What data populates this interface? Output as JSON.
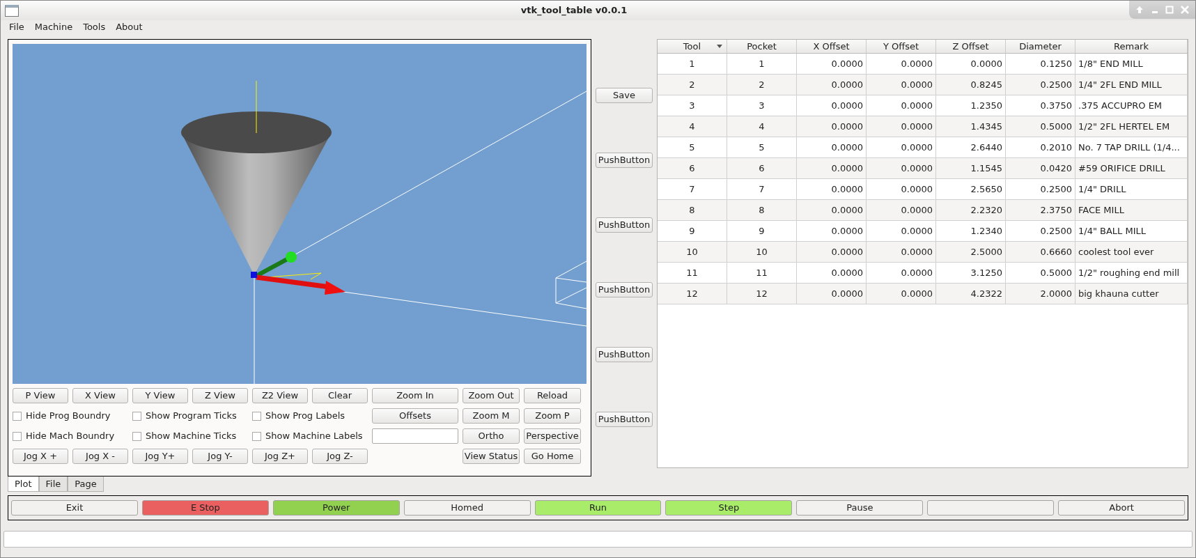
{
  "window": {
    "title": "vtk_tool_table v0.0.1"
  },
  "menu": [
    "File",
    "Machine",
    "Tools",
    "About"
  ],
  "view_controls": [
    [
      {
        "kind": "button",
        "label": "P View"
      },
      {
        "kind": "button",
        "label": "X View"
      },
      {
        "kind": "button",
        "label": "Y View"
      },
      {
        "kind": "button",
        "label": "Z View"
      },
      {
        "kind": "button",
        "label": "Z2 View"
      },
      {
        "kind": "button",
        "label": "Clear"
      },
      {
        "kind": "button",
        "label": "Zoom In"
      },
      {
        "kind": "button",
        "label": "Zoom Out"
      },
      {
        "kind": "button",
        "label": "Reload"
      }
    ],
    [
      {
        "kind": "checkbox",
        "label": "Hide Prog Boundry",
        "checked": false
      },
      {
        "kind": "checkbox",
        "label": "Show Program Ticks",
        "checked": false
      },
      {
        "kind": "checkbox",
        "label": "Show Prog Labels",
        "checked": false
      },
      {
        "kind": "button",
        "label": "Offsets"
      },
      {
        "kind": "button",
        "label": "Zoom M"
      },
      {
        "kind": "button",
        "label": "Zoom P"
      }
    ],
    [
      {
        "kind": "checkbox",
        "label": "Hide Mach Boundry",
        "checked": false
      },
      {
        "kind": "checkbox",
        "label": "Show Machine Ticks",
        "checked": false
      },
      {
        "kind": "checkbox",
        "label": "Show Machine Labels",
        "checked": false
      },
      {
        "kind": "input"
      },
      {
        "kind": "button",
        "label": "Ortho"
      },
      {
        "kind": "button",
        "label": "Perspective"
      }
    ],
    [
      {
        "kind": "button",
        "label": "Jog X +"
      },
      {
        "kind": "button",
        "label": "Jog X -"
      },
      {
        "kind": "button",
        "label": "Jog Y+"
      },
      {
        "kind": "button",
        "label": "Jog Y-"
      },
      {
        "kind": "button",
        "label": "Jog Z+"
      },
      {
        "kind": "button",
        "label": "Jog Z-"
      },
      {
        "kind": "spacer"
      },
      {
        "kind": "button",
        "label": "View Status"
      },
      {
        "kind": "button",
        "label": "Go Home"
      }
    ]
  ],
  "side_buttons": [
    "Save",
    "PushButton",
    "PushButton",
    "PushButton",
    "PushButton",
    "PushButton"
  ],
  "table": {
    "columns": [
      {
        "label": "Tool",
        "sorted": true
      },
      {
        "label": "Pocket",
        "sorted": false
      },
      {
        "label": "X Offset",
        "sorted": false
      },
      {
        "label": "Y Offset",
        "sorted": false
      },
      {
        "label": "Z Offset",
        "sorted": false
      },
      {
        "label": "Diameter",
        "sorted": false
      },
      {
        "label": "Remark",
        "sorted": false
      }
    ],
    "rows": [
      [
        "1",
        "1",
        "0.0000",
        "0.0000",
        "0.0000",
        "0.1250",
        "1/8\" END MILL"
      ],
      [
        "2",
        "2",
        "0.0000",
        "0.0000",
        "0.8245",
        "0.2500",
        "1/4\" 2FL END MILL"
      ],
      [
        "3",
        "3",
        "0.0000",
        "0.0000",
        "1.2350",
        "0.3750",
        ".375 ACCUPRO EM"
      ],
      [
        "4",
        "4",
        "0.0000",
        "0.0000",
        "1.4345",
        "0.5000",
        "1/2\" 2FL HERTEL EM"
      ],
      [
        "5",
        "5",
        "0.0000",
        "0.0000",
        "2.6440",
        "0.2010",
        "No. 7 TAP DRILL (1/4..."
      ],
      [
        "6",
        "6",
        "0.0000",
        "0.0000",
        "1.1545",
        "0.0420",
        "#59 ORIFICE DRILL"
      ],
      [
        "7",
        "7",
        "0.0000",
        "0.0000",
        "2.5650",
        "0.2500",
        "1/4\" DRILL"
      ],
      [
        "8",
        "8",
        "0.0000",
        "0.0000",
        "2.2320",
        "2.3750",
        "FACE MILL"
      ],
      [
        "9",
        "9",
        "0.0000",
        "0.0000",
        "1.2340",
        "0.2500",
        "1/4\" BALL MILL"
      ],
      [
        "10",
        "10",
        "0.0000",
        "0.0000",
        "2.5000",
        "0.6660",
        "coolest tool ever"
      ],
      [
        "11",
        "11",
        "0.0000",
        "0.0000",
        "3.1250",
        "0.5000",
        "1/2\" roughing end mill"
      ],
      [
        "12",
        "12",
        "0.0000",
        "0.0000",
        "4.2322",
        "2.0000",
        "big khauna cutter"
      ]
    ]
  },
  "tabs": [
    {
      "label": "Plot",
      "selected": true
    },
    {
      "label": "File",
      "selected": false
    },
    {
      "label": "Page",
      "selected": false
    }
  ],
  "control_bar": [
    {
      "label": "Exit",
      "color": "#f2f1f0"
    },
    {
      "label": "E Stop",
      "color": "#ea6060"
    },
    {
      "label": "Power",
      "color": "#92d050"
    },
    {
      "label": "Homed",
      "color": "#f2f1f0"
    },
    {
      "label": "Run",
      "color": "#a8ec6a"
    },
    {
      "label": "Step",
      "color": "#a8ec6a"
    },
    {
      "label": "Pause",
      "color": "#f2f1f0"
    },
    {
      "color": "#f2f1f0"
    },
    {
      "label": "Abort",
      "color": "#f2f1f0"
    }
  ]
}
